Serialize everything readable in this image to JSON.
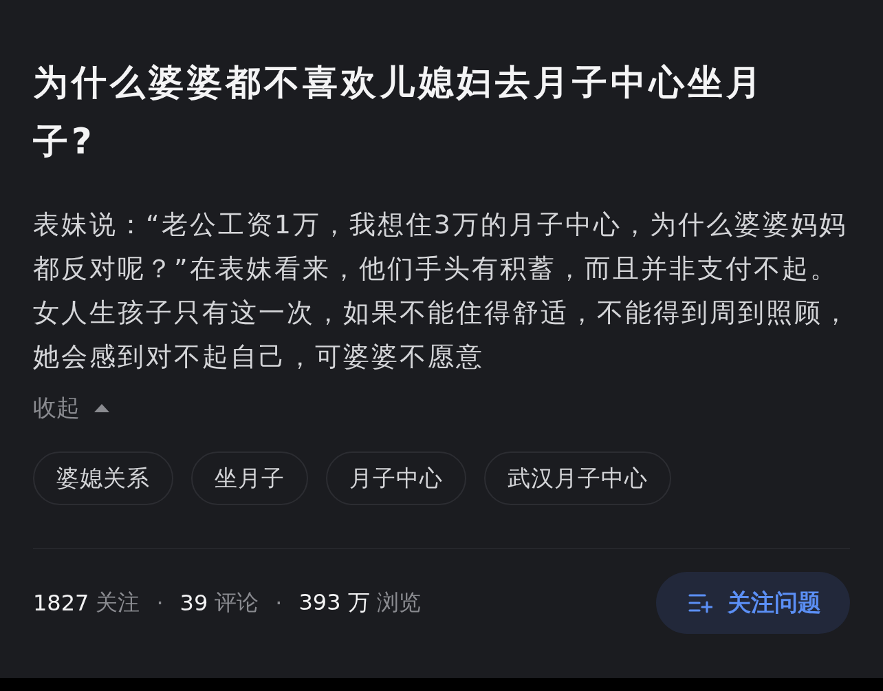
{
  "question": {
    "title": "为什么婆婆都不喜欢儿媳妇去月子中心坐月子?",
    "body": "表妹说：“老公工资1万，我想住3万的月子中心，为什么婆婆妈妈都反对呢？”在表妹看来，他们手头有积蓄，而且并非支付不起。女人生孩子只有这一次，如果不能住得舒适，不能得到周到照顾，她会感到对不起自己，可婆婆不愿意",
    "collapse": {
      "label": "收起",
      "expanded": true
    },
    "tags": [
      "婆媳关系",
      "坐月子",
      "月子中心",
      "武汉月子中心"
    ],
    "stats": [
      {
        "number": "1827",
        "label": "关注"
      },
      {
        "number": "39",
        "label": "评论"
      },
      {
        "number": "393 万",
        "label": "浏览"
      }
    ],
    "separator": "·",
    "follow_button": "关注问题"
  }
}
